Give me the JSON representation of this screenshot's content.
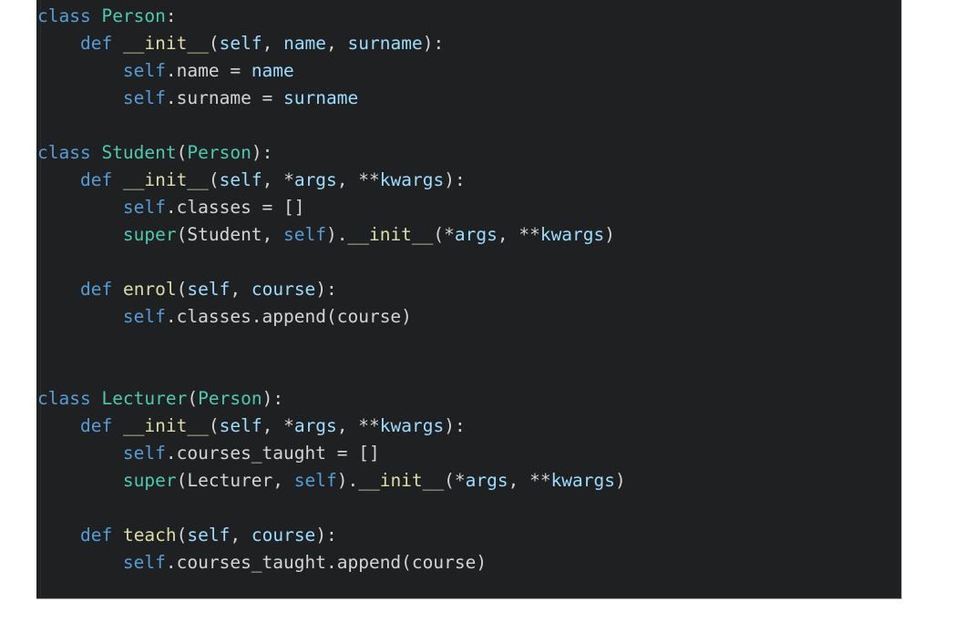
{
  "app": {
    "kind": "code-snippet-image",
    "language": "python",
    "background_color": "#ffffff",
    "code_background_color": "#1f2021",
    "default_text_color": "#d4d4d4"
  },
  "theme": {
    "keyword_color": "#569cd6",
    "class_color": "#4ec9b0",
    "function_color": "#dcdcaa",
    "variable_color": "#9cdcfe",
    "plain_color": "#d4d4d4"
  },
  "code": {
    "plain_text": "class Person:\n    def __init__(self, name, surname):\n        self.name = name\n        self.surname = surname\n\nclass Student(Person):\n    def __init__(self, *args, **kwargs):\n        self.classes = []\n        super(Student, self).__init__(*args, **kwargs)\n\n    def enrol(self, course):\n        self.classes.append(course)\n\n\nclass Lecturer(Person):\n    def __init__(self, *args, **kwargs):\n        self.courses_taught = []\n        super(Lecturer, self).__init__(*args, **kwargs)\n\n    def teach(self, course):\n        self.courses_taught.append(course)",
    "lines": [
      {
        "index": 1,
        "text": "class Person:",
        "tokens": [
          {
            "t": "class",
            "c": "keyword"
          },
          {
            "t": " ",
            "c": "plain"
          },
          {
            "t": "Person",
            "c": "class"
          },
          {
            "t": ":",
            "c": "plain"
          }
        ]
      },
      {
        "index": 2,
        "text": "    def __init__(self, name, surname):",
        "tokens": [
          {
            "t": "    ",
            "c": "plain"
          },
          {
            "t": "def",
            "c": "keyword"
          },
          {
            "t": " ",
            "c": "plain"
          },
          {
            "t": "__init__",
            "c": "function"
          },
          {
            "t": "(",
            "c": "plain"
          },
          {
            "t": "self",
            "c": "variable"
          },
          {
            "t": ", ",
            "c": "plain"
          },
          {
            "t": "name",
            "c": "variable"
          },
          {
            "t": ", ",
            "c": "plain"
          },
          {
            "t": "surname",
            "c": "variable"
          },
          {
            "t": "):",
            "c": "plain"
          }
        ]
      },
      {
        "index": 3,
        "text": "        self.name = name",
        "tokens": [
          {
            "t": "        ",
            "c": "plain"
          },
          {
            "t": "self",
            "c": "keyword"
          },
          {
            "t": ".name = ",
            "c": "plain"
          },
          {
            "t": "name",
            "c": "variable"
          }
        ]
      },
      {
        "index": 4,
        "text": "        self.surname = surname",
        "tokens": [
          {
            "t": "        ",
            "c": "plain"
          },
          {
            "t": "self",
            "c": "keyword"
          },
          {
            "t": ".surname = ",
            "c": "plain"
          },
          {
            "t": "surname",
            "c": "variable"
          }
        ]
      },
      {
        "index": 5,
        "text": "",
        "tokens": []
      },
      {
        "index": 6,
        "text": "class Student(Person):",
        "tokens": [
          {
            "t": "class",
            "c": "keyword"
          },
          {
            "t": " ",
            "c": "plain"
          },
          {
            "t": "Student",
            "c": "class"
          },
          {
            "t": "(",
            "c": "plain"
          },
          {
            "t": "Person",
            "c": "class"
          },
          {
            "t": "):",
            "c": "plain"
          }
        ]
      },
      {
        "index": 7,
        "text": "    def __init__(self, *args, **kwargs):",
        "tokens": [
          {
            "t": "    ",
            "c": "plain"
          },
          {
            "t": "def",
            "c": "keyword"
          },
          {
            "t": " ",
            "c": "plain"
          },
          {
            "t": "__init__",
            "c": "function"
          },
          {
            "t": "(",
            "c": "plain"
          },
          {
            "t": "self",
            "c": "variable"
          },
          {
            "t": ", *",
            "c": "plain"
          },
          {
            "t": "args",
            "c": "variable"
          },
          {
            "t": ", **",
            "c": "plain"
          },
          {
            "t": "kwargs",
            "c": "variable"
          },
          {
            "t": "):",
            "c": "plain"
          }
        ]
      },
      {
        "index": 8,
        "text": "        self.classes = []",
        "tokens": [
          {
            "t": "        ",
            "c": "plain"
          },
          {
            "t": "self",
            "c": "keyword"
          },
          {
            "t": ".classes = []",
            "c": "plain"
          }
        ]
      },
      {
        "index": 9,
        "text": "        super(Student, self).__init__(*args, **kwargs)",
        "tokens": [
          {
            "t": "        ",
            "c": "plain"
          },
          {
            "t": "super",
            "c": "class"
          },
          {
            "t": "(Student, ",
            "c": "plain"
          },
          {
            "t": "self",
            "c": "keyword"
          },
          {
            "t": ").",
            "c": "plain"
          },
          {
            "t": "__init__",
            "c": "function"
          },
          {
            "t": "(*",
            "c": "plain"
          },
          {
            "t": "args",
            "c": "variable"
          },
          {
            "t": ", **",
            "c": "plain"
          },
          {
            "t": "kwargs",
            "c": "variable"
          },
          {
            "t": ")",
            "c": "plain"
          }
        ]
      },
      {
        "index": 10,
        "text": "",
        "tokens": []
      },
      {
        "index": 11,
        "text": "    def enrol(self, course):",
        "tokens": [
          {
            "t": "    ",
            "c": "plain"
          },
          {
            "t": "def",
            "c": "keyword"
          },
          {
            "t": " ",
            "c": "plain"
          },
          {
            "t": "enrol",
            "c": "function"
          },
          {
            "t": "(",
            "c": "plain"
          },
          {
            "t": "self",
            "c": "variable"
          },
          {
            "t": ", ",
            "c": "plain"
          },
          {
            "t": "course",
            "c": "variable"
          },
          {
            "t": "):",
            "c": "plain"
          }
        ]
      },
      {
        "index": 12,
        "text": "        self.classes.append(course)",
        "tokens": [
          {
            "t": "        ",
            "c": "plain"
          },
          {
            "t": "self",
            "c": "keyword"
          },
          {
            "t": ".classes.append(course)",
            "c": "plain"
          }
        ]
      },
      {
        "index": 13,
        "text": "",
        "tokens": []
      },
      {
        "index": 14,
        "text": "",
        "tokens": []
      },
      {
        "index": 15,
        "text": "class Lecturer(Person):",
        "tokens": [
          {
            "t": "class",
            "c": "keyword"
          },
          {
            "t": " ",
            "c": "plain"
          },
          {
            "t": "Lecturer",
            "c": "class"
          },
          {
            "t": "(",
            "c": "plain"
          },
          {
            "t": "Person",
            "c": "class"
          },
          {
            "t": "):",
            "c": "plain"
          }
        ]
      },
      {
        "index": 16,
        "text": "    def __init__(self, *args, **kwargs):",
        "tokens": [
          {
            "t": "    ",
            "c": "plain"
          },
          {
            "t": "def",
            "c": "keyword"
          },
          {
            "t": " ",
            "c": "plain"
          },
          {
            "t": "__init__",
            "c": "function"
          },
          {
            "t": "(",
            "c": "plain"
          },
          {
            "t": "self",
            "c": "variable"
          },
          {
            "t": ", *",
            "c": "plain"
          },
          {
            "t": "args",
            "c": "variable"
          },
          {
            "t": ", **",
            "c": "plain"
          },
          {
            "t": "kwargs",
            "c": "variable"
          },
          {
            "t": "):",
            "c": "plain"
          }
        ]
      },
      {
        "index": 17,
        "text": "        self.courses_taught = []",
        "tokens": [
          {
            "t": "        ",
            "c": "plain"
          },
          {
            "t": "self",
            "c": "keyword"
          },
          {
            "t": ".courses_taught = []",
            "c": "plain"
          }
        ]
      },
      {
        "index": 18,
        "text": "        super(Lecturer, self).__init__(*args, **kwargs)",
        "tokens": [
          {
            "t": "        ",
            "c": "plain"
          },
          {
            "t": "super",
            "c": "class"
          },
          {
            "t": "(Lecturer, ",
            "c": "plain"
          },
          {
            "t": "self",
            "c": "keyword"
          },
          {
            "t": ").",
            "c": "plain"
          },
          {
            "t": "__init__",
            "c": "function"
          },
          {
            "t": "(*",
            "c": "plain"
          },
          {
            "t": "args",
            "c": "variable"
          },
          {
            "t": ", **",
            "c": "plain"
          },
          {
            "t": "kwargs",
            "c": "variable"
          },
          {
            "t": ")",
            "c": "plain"
          }
        ]
      },
      {
        "index": 19,
        "text": "",
        "tokens": []
      },
      {
        "index": 20,
        "text": "    def teach(self, course):",
        "tokens": [
          {
            "t": "    ",
            "c": "plain"
          },
          {
            "t": "def",
            "c": "keyword"
          },
          {
            "t": " ",
            "c": "plain"
          },
          {
            "t": "teach",
            "c": "function"
          },
          {
            "t": "(",
            "c": "plain"
          },
          {
            "t": "self",
            "c": "variable"
          },
          {
            "t": ", ",
            "c": "plain"
          },
          {
            "t": "course",
            "c": "variable"
          },
          {
            "t": "):",
            "c": "plain"
          }
        ]
      },
      {
        "index": 21,
        "text": "        self.courses_taught.append(course)",
        "tokens": [
          {
            "t": "        ",
            "c": "plain"
          },
          {
            "t": "self",
            "c": "keyword"
          },
          {
            "t": ".courses_taught.append(course)",
            "c": "plain"
          }
        ]
      }
    ]
  }
}
